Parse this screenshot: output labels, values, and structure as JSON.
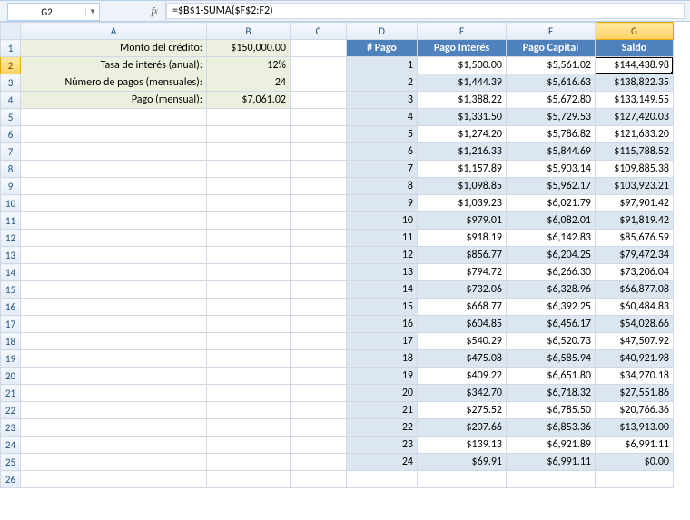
{
  "name_box": "G2",
  "formula": "=$B$1-SUMA($F$2:F2)",
  "columns": [
    "A",
    "B",
    "C",
    "D",
    "E",
    "F",
    "G"
  ],
  "selected_col": "G",
  "selected_row": 2,
  "params": {
    "r1_label": "Monto del crédito:",
    "r1_value": "$150,000.00",
    "r2_label": "Tasa de interés (anual):",
    "r2_value": "12%",
    "r3_label": "Número de pagos (mensuales):",
    "r3_value": "24",
    "r4_label": "Pago (mensual):",
    "r4_value": "$7,061.02"
  },
  "table": {
    "headers": {
      "d": "# Pago",
      "e": "Pago Interés",
      "f": "Pago Capital",
      "g": "Saldo"
    },
    "rows": [
      {
        "n": "1",
        "pi": "$1,500.00",
        "pc": "$5,561.02",
        "s": "$144,438.98"
      },
      {
        "n": "2",
        "pi": "$1,444.39",
        "pc": "$5,616.63",
        "s": "$138,822.35"
      },
      {
        "n": "3",
        "pi": "$1,388.22",
        "pc": "$5,672.80",
        "s": "$133,149.55"
      },
      {
        "n": "4",
        "pi": "$1,331.50",
        "pc": "$5,729.53",
        "s": "$127,420.03"
      },
      {
        "n": "5",
        "pi": "$1,274.20",
        "pc": "$5,786.82",
        "s": "$121,633.20"
      },
      {
        "n": "6",
        "pi": "$1,216.33",
        "pc": "$5,844.69",
        "s": "$115,788.52"
      },
      {
        "n": "7",
        "pi": "$1,157.89",
        "pc": "$5,903.14",
        "s": "$109,885.38"
      },
      {
        "n": "8",
        "pi": "$1,098.85",
        "pc": "$5,962.17",
        "s": "$103,923.21"
      },
      {
        "n": "9",
        "pi": "$1,039.23",
        "pc": "$6,021.79",
        "s": "$97,901.42"
      },
      {
        "n": "10",
        "pi": "$979.01",
        "pc": "$6,082.01",
        "s": "$91,819.42"
      },
      {
        "n": "11",
        "pi": "$918.19",
        "pc": "$6,142.83",
        "s": "$85,676.59"
      },
      {
        "n": "12",
        "pi": "$856.77",
        "pc": "$6,204.25",
        "s": "$79,472.34"
      },
      {
        "n": "13",
        "pi": "$794.72",
        "pc": "$6,266.30",
        "s": "$73,206.04"
      },
      {
        "n": "14",
        "pi": "$732.06",
        "pc": "$6,328.96",
        "s": "$66,877.08"
      },
      {
        "n": "15",
        "pi": "$668.77",
        "pc": "$6,392.25",
        "s": "$60,484.83"
      },
      {
        "n": "16",
        "pi": "$604.85",
        "pc": "$6,456.17",
        "s": "$54,028.66"
      },
      {
        "n": "17",
        "pi": "$540.29",
        "pc": "$6,520.73",
        "s": "$47,507.92"
      },
      {
        "n": "18",
        "pi": "$475.08",
        "pc": "$6,585.94",
        "s": "$40,921.98"
      },
      {
        "n": "19",
        "pi": "$409.22",
        "pc": "$6,651.80",
        "s": "$34,270.18"
      },
      {
        "n": "20",
        "pi": "$342.70",
        "pc": "$6,718.32",
        "s": "$27,551.86"
      },
      {
        "n": "21",
        "pi": "$275.52",
        "pc": "$6,785.50",
        "s": "$20,766.36"
      },
      {
        "n": "22",
        "pi": "$207.66",
        "pc": "$6,853.36",
        "s": "$13,913.00"
      },
      {
        "n": "23",
        "pi": "$139.13",
        "pc": "$6,921.89",
        "s": "$6,991.11"
      },
      {
        "n": "24",
        "pi": "$69.91",
        "pc": "$6,991.11",
        "s": "$0.00"
      }
    ]
  },
  "total_visible_rows": 26
}
